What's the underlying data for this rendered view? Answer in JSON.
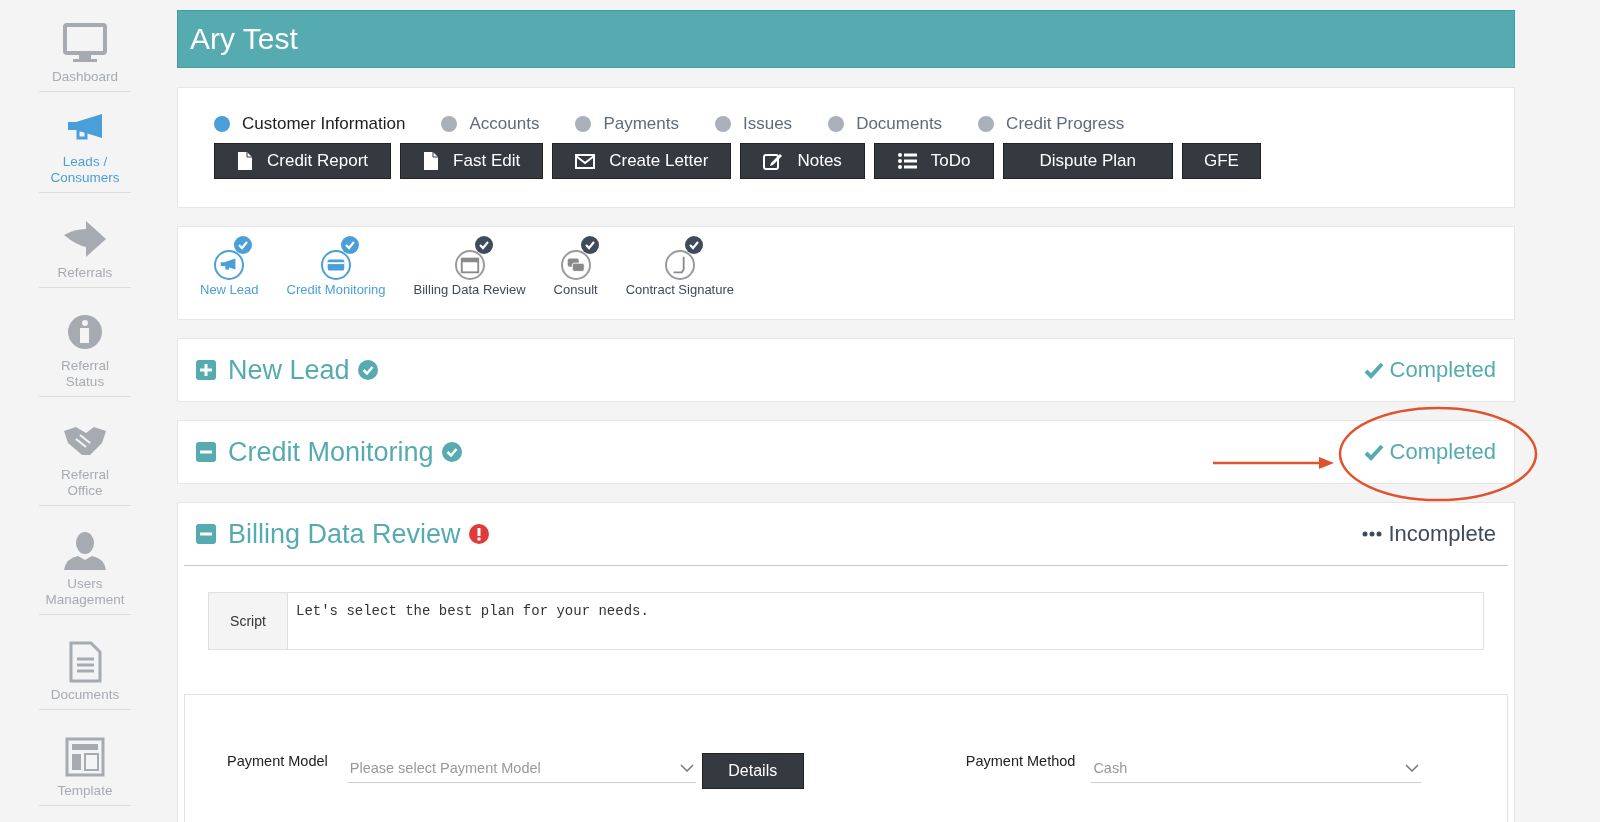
{
  "sidebar": {
    "items": [
      {
        "label": "Dashboard",
        "selected": false
      },
      {
        "label": "Leads / Consumers",
        "selected": true
      },
      {
        "label": "Referrals",
        "selected": false
      },
      {
        "label": "Referral Status",
        "selected": false
      },
      {
        "label": "Referral Office",
        "selected": false
      },
      {
        "label": "Users Management",
        "selected": false
      },
      {
        "label": "Documents",
        "selected": false
      },
      {
        "label": "Template",
        "selected": false
      }
    ]
  },
  "title": "Ary Test",
  "tabs": [
    {
      "label": "Customer Information",
      "selected": true
    },
    {
      "label": "Accounts",
      "selected": false
    },
    {
      "label": "Payments",
      "selected": false
    },
    {
      "label": "Issues",
      "selected": false
    },
    {
      "label": "Documents",
      "selected": false
    },
    {
      "label": "Credit Progress",
      "selected": false
    }
  ],
  "actions": [
    {
      "label": "Credit Report",
      "kind": "file"
    },
    {
      "label": "Fast Edit",
      "kind": "file"
    },
    {
      "label": "Create Letter",
      "kind": "mail"
    },
    {
      "label": "Notes",
      "kind": "edit"
    },
    {
      "label": "ToDo",
      "kind": "list"
    },
    {
      "label": "Dispute Plan",
      "kind": "plain"
    },
    {
      "label": "GFE",
      "kind": "plain"
    }
  ],
  "steps": [
    {
      "label": "New Lead",
      "selected": true
    },
    {
      "label": "Credit Monitoring",
      "selected": true
    },
    {
      "label": "Billing Data Review",
      "selected": false
    },
    {
      "label": "Consult",
      "selected": false
    },
    {
      "label": "Contract Signature",
      "selected": false
    }
  ],
  "sections": [
    {
      "title": "New Lead",
      "expanded": false,
      "completed": true,
      "status": "Completed"
    },
    {
      "title": "Credit Monitoring",
      "expanded": true,
      "completed": true,
      "status": "Completed"
    },
    {
      "title": "Billing Data Review",
      "expanded": true,
      "completed": false,
      "status": "Incomplete"
    }
  ],
  "script": {
    "label": "Script",
    "text": "Let's select the best plan for your needs."
  },
  "form": {
    "payment_model": {
      "label": "Payment Model",
      "placeholder": "Please select Payment Model"
    },
    "details_button": "Details",
    "payment_method": {
      "label": "Payment Method",
      "value": "Cash"
    }
  }
}
